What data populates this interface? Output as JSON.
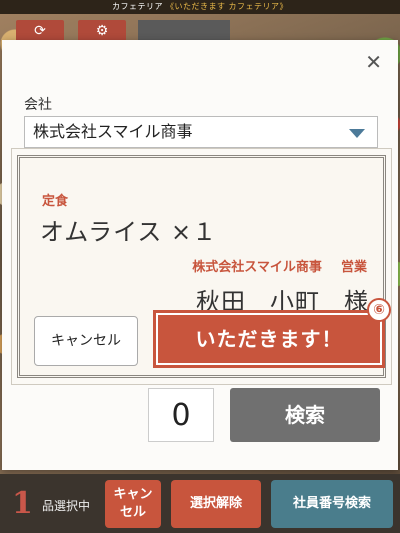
{
  "app": {
    "title_prefix": "カフェテリア",
    "title_name": "《いただきます カフェテリア》"
  },
  "background_toolbar": {
    "refresh_icon": "refresh-icon",
    "settings_icon": "gear-icon"
  },
  "modal": {
    "company_label": "会社",
    "company_value": "株式会社スマイル商事",
    "quantity": "0",
    "search_label": "検索"
  },
  "confirm": {
    "category": "定食",
    "item": "オムライス ×１",
    "company": "株式会社スマイル商事",
    "department": "営業",
    "last_name": "秋田",
    "first_name": "小町",
    "honorific": "様",
    "cancel_label": "キャンセル",
    "confirm_label": "いただきます！",
    "step_badge": "⑥"
  },
  "bottom_bar": {
    "selected_count": "1",
    "selected_label": "品選択中",
    "cancel_label_line1": "キャン",
    "cancel_label_line2": "セル",
    "clear_label": "選択解除",
    "employee_search_label": "社員番号検索"
  },
  "colors": {
    "accent_red": "#c8553d",
    "search_gray": "#707070",
    "teal": "#4a7d8c",
    "header_dark": "#2d2419"
  }
}
